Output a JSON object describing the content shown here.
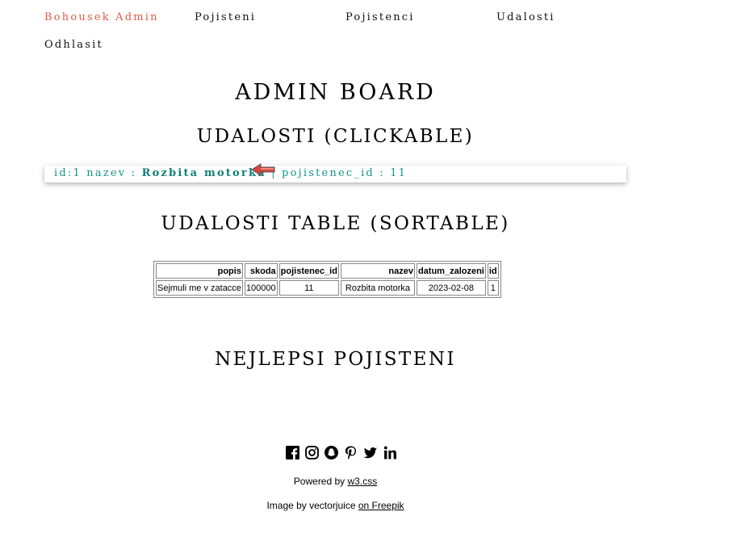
{
  "nav": {
    "brand": "Bohousek Admin",
    "items": [
      "Pojisteni",
      "Pojistenci",
      "Udalosti"
    ],
    "logout": "Odhlasit"
  },
  "main": {
    "title": "ADMIN BOARD",
    "clickable_heading": "UDALOSTI (CLICKABLE)",
    "event_card": {
      "id_label": "id:",
      "id": "1",
      "nazev_label": "nazev :",
      "nazev": "Rozbita motorka",
      "separator": "|",
      "pojistenec_label": "pojistenec_id :",
      "pojistenec_id": "11"
    },
    "table_heading": "UDALOSTI TABLE (SORTABLE)",
    "table": {
      "columns": [
        "popis",
        "skoda",
        "pojistenec_id",
        "nazev",
        "datum_zalozeni",
        "id"
      ],
      "rows": [
        [
          "Sejmuli me v zatacce",
          "100000",
          "11",
          "Rozbita motorka",
          "2023-02-08",
          "1"
        ]
      ]
    },
    "best_heading": "NEJLEPSI POJISTENI"
  },
  "footer": {
    "social_icons": [
      "facebook-icon",
      "instagram-icon",
      "snapchat-icon",
      "pinterest-icon",
      "twitter-icon",
      "linkedin-icon"
    ],
    "powered_prefix": "Powered by",
    "powered_link": "w3.css",
    "image_prefix": "Image by vectorjuice",
    "image_link": "on Freepik"
  },
  "colors": {
    "brand": "#e35a45",
    "card_text": "#13958a"
  }
}
